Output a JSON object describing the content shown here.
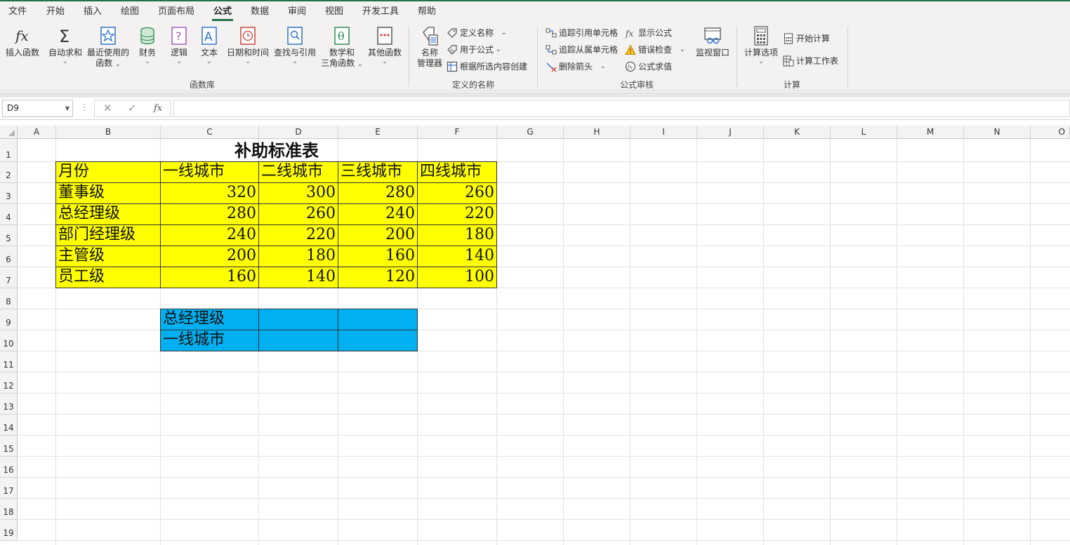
{
  "menu": {
    "items": [
      "文件",
      "开始",
      "插入",
      "绘图",
      "页面布局",
      "公式",
      "数据",
      "审阅",
      "视图",
      "开发工具",
      "帮助"
    ],
    "active": "公式"
  },
  "ribbon": {
    "insert_function": "插入函数",
    "autosum": "自动求和",
    "recent_1": "最近使用的",
    "recent_2": "函数",
    "financial": "财务",
    "logical": "逻辑",
    "text": "文本",
    "datetime": "日期和时间",
    "lookup": "查找与引用",
    "math_1": "数学和",
    "math_2": "三角函数",
    "other": "其他函数",
    "group_library": "函数库",
    "name_mgr_1": "名称",
    "name_mgr_2": "管理器",
    "define_name": "定义名称",
    "use_in_formula": "用于公式",
    "create_from_selection": "根据所选内容创建",
    "group_names": "定义的名称",
    "trace_precedents": "追踪引用单元格",
    "trace_dependents": "追踪从属单元格",
    "remove_arrows": "删除箭头",
    "show_formulas": "显示公式",
    "error_checking": "错误检查",
    "evaluate_formula": "公式求值",
    "watch_window": "监视窗口",
    "group_audit": "公式审核",
    "calc_options": "计算选项",
    "calc_now": "开始计算",
    "calc_sheet": "计算工作表",
    "group_calc": "计算"
  },
  "formula_bar": {
    "name_box": "D9",
    "cancel": "✕",
    "enter": "✓",
    "fx": "fx",
    "content": ""
  },
  "columns": [
    "A",
    "B",
    "C",
    "D",
    "E",
    "F",
    "G",
    "H",
    "I",
    "J",
    "K",
    "L",
    "M",
    "N",
    "O"
  ],
  "rows": [
    "1",
    "2",
    "3",
    "4",
    "5",
    "6",
    "7",
    "8",
    "9",
    "10",
    "11",
    "12",
    "13",
    "14",
    "15",
    "16",
    "17",
    "18",
    "19"
  ],
  "sheet": {
    "title": "补助标准表",
    "header": [
      "月份",
      "一线城市",
      "二线城市",
      "三线城市",
      "四线城市"
    ],
    "data": [
      [
        "董事级",
        "320",
        "300",
        "280",
        "260"
      ],
      [
        "总经理级",
        "280",
        "260",
        "240",
        "220"
      ],
      [
        "部门经理级",
        "240",
        "220",
        "200",
        "180"
      ],
      [
        "主管级",
        "200",
        "180",
        "160",
        "140"
      ],
      [
        "员工级",
        "160",
        "140",
        "120",
        "100"
      ]
    ],
    "lookup": {
      "level": "总经理级",
      "city": "一线城市"
    }
  },
  "colors": {
    "accent": "#217346",
    "table_fill": "#ffff00",
    "lookup_fill": "#00b0f0"
  }
}
